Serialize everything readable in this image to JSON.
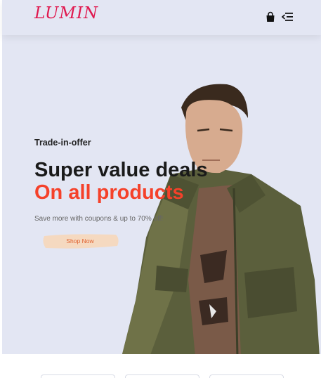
{
  "header": {
    "logo": "LUMIN",
    "icons": [
      "shopping-bag-icon",
      "menu-icon"
    ]
  },
  "hero": {
    "kicker": "Trade-in-offer",
    "title": "Super value deals",
    "subtitle": "On all products",
    "text": "Save more with coupons & up to 70% off!",
    "button_label": "Shop Now"
  },
  "colors": {
    "accent": "#e0184e",
    "highlight": "#f5412a",
    "hero_bg": "#e3e6f3",
    "button_bg": "#f5d9c0"
  }
}
